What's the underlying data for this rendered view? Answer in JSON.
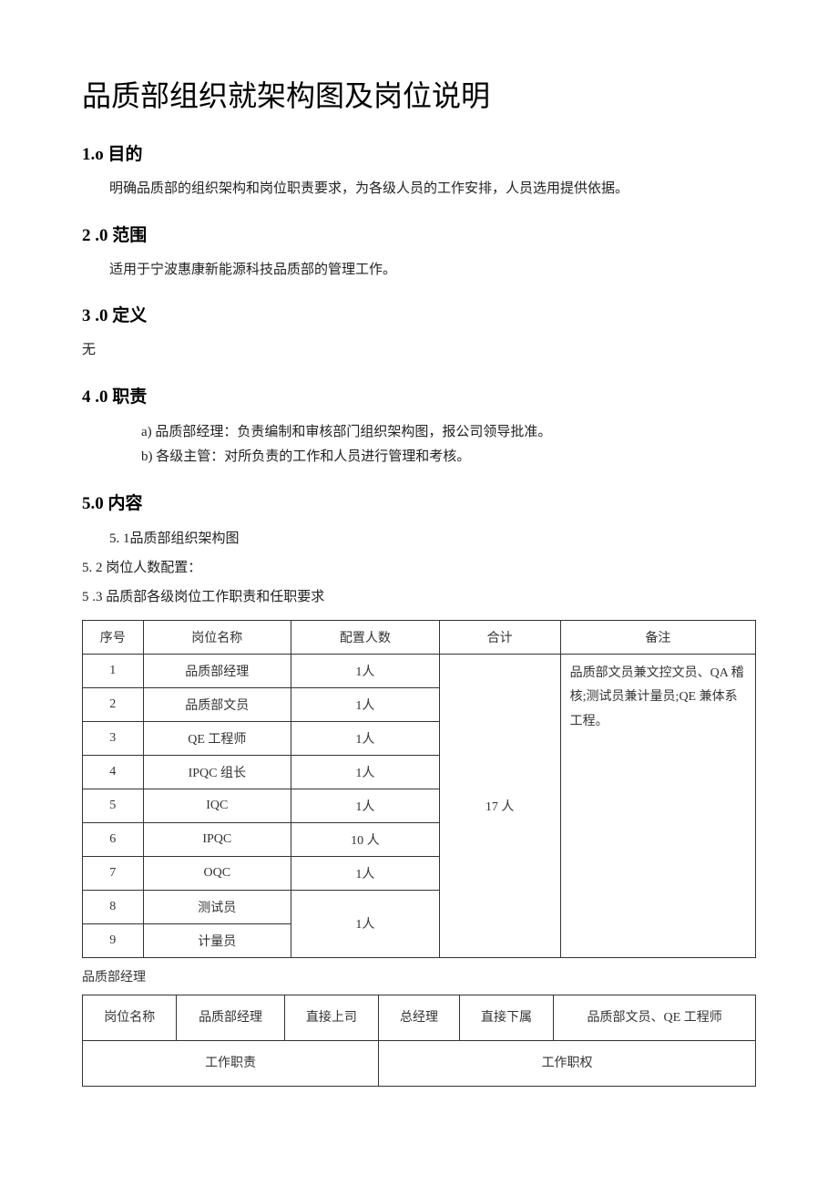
{
  "title": "品质部组织就架构图及岗位说明",
  "sections": {
    "s1": {
      "heading": "1.o 目的",
      "body": "明确品质部的组织架构和岗位职责要求，为各级人员的工作安排，人员选用提供依据。"
    },
    "s2": {
      "heading": "2  .0 范围",
      "body": "适用于宁波惠康新能源科技品质部的管理工作。"
    },
    "s3": {
      "heading": "3  .0 定义",
      "body": "无"
    },
    "s4": {
      "heading": "4  .0 职责",
      "items": {
        "a": "a)  品质部经理：负责编制和审核部门组织架构图，报公司领导批准。",
        "b": "b)  各级主管：对所负责的工作和人员进行管理和考核。"
      }
    },
    "s5": {
      "heading": "5.0 内容",
      "sub1": "5.  1品质部组织架构图",
      "sub2": "5.  2 岗位人数配置：",
      "sub3": "5  .3 品质部各级岗位工作职责和任职要求"
    }
  },
  "table1": {
    "headers": {
      "c1": "序号",
      "c2": "岗位名称",
      "c3": "配置人数",
      "c4": "合计",
      "c5": "备注"
    },
    "rows": [
      {
        "no": "1",
        "name": "品质部经理",
        "count": "1人"
      },
      {
        "no": "2",
        "name": "品质部文员",
        "count": "1人"
      },
      {
        "no": "3",
        "name": "QE 工程师",
        "count": "1人"
      },
      {
        "no": "4",
        "name": "IPQC 组长",
        "count": "1人"
      },
      {
        "no": "5",
        "name": "IQC",
        "count": "1人"
      },
      {
        "no": "6",
        "name": "IPQC",
        "count": "10 人"
      },
      {
        "no": "7",
        "name": "OQC",
        "count": "1人"
      },
      {
        "no": "8",
        "name": "测试员"
      },
      {
        "no": "9",
        "name": "计量员"
      }
    ],
    "merged_count89": "1人",
    "total": "17 人",
    "remark": "品质部文员兼文控文员、QA 稽核;测试员兼计量员;QE 兼体系工程。"
  },
  "subtitle2": "品质部经理",
  "table2": {
    "r1": {
      "c1": "岗位名称",
      "c2": "品质部经理",
      "c3": "直接上司",
      "c4": "总经理",
      "c5": "直接下属",
      "c6": "品质部文员、QE 工程师"
    },
    "r2": {
      "c1": "工作职责",
      "c2": "工作职权"
    }
  }
}
